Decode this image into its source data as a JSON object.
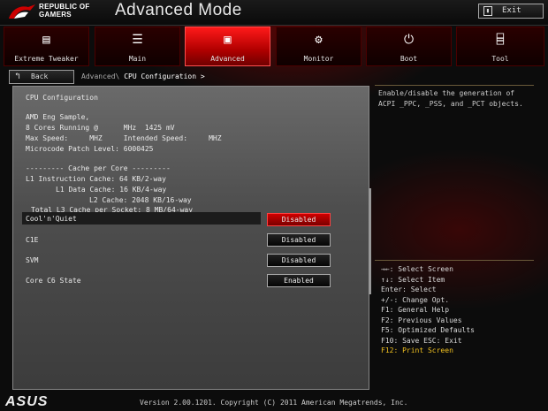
{
  "header": {
    "brand_line1": "REPUBLIC OF",
    "brand_line2": "GAMERS",
    "title": "Advanced Mode",
    "exit_label": "Exit"
  },
  "tabs": [
    {
      "label": "Extreme Tweaker",
      "icon": "tweaker-icon"
    },
    {
      "label": "Main",
      "icon": "list-icon"
    },
    {
      "label": "Advanced",
      "icon": "advanced-icon",
      "active": true
    },
    {
      "label": "Monitor",
      "icon": "monitor-icon"
    },
    {
      "label": "Boot",
      "icon": "power-icon"
    },
    {
      "label": "Tool",
      "icon": "tool-icon"
    }
  ],
  "nav": {
    "back_label": "Back",
    "breadcrumb_prefix": "Advanced\\",
    "breadcrumb_current": "CPU Configuration >"
  },
  "info": {
    "section_title": "CPU Configuration",
    "line1": "AMD Eng Sample,",
    "line2": "8 Cores Running @      MHz  1425 mV",
    "line3": "Max Speed:     MHZ     Intended Speed:     MHZ",
    "line4": "Microcode Patch Level: 6000425",
    "cache_header": "--------- Cache per Core ---------",
    "l1i": "L1 Instruction Cache: 64 KB/2-way",
    "l1d": "L1 Data Cache: 16 KB/4-way",
    "l2": "L2 Cache: 2048 KB/16-way",
    "l3": "Total L3 Cache per Socket: 8 MB/64-way"
  },
  "settings": [
    {
      "label": "Cool'n'Quiet",
      "value": "Disabled",
      "selected": true
    },
    {
      "label": "C1E",
      "value": "Disabled"
    },
    {
      "label": "SVM",
      "value": "Disabled"
    },
    {
      "label": "Core C6 State",
      "value": "Enabled"
    }
  ],
  "help": {
    "text_line1": "Enable/disable the generation of",
    "text_line2": "ACPI _PPC, _PSS, and _PCT objects."
  },
  "keys": [
    "→←: Select Screen",
    "↑↓: Select Item",
    "Enter: Select",
    "+/-: Change Opt.",
    "F1: General Help",
    "F2: Previous Values",
    "F5: Optimized Defaults",
    "F10: Save  ESC: Exit"
  ],
  "key_highlight": "F12: Print Screen",
  "footer": {
    "logo": "ASUS",
    "version": "Version 2.00.1201. Copyright (C) 2011 American Megatrends, Inc."
  },
  "colors": {
    "accent": "#d00000",
    "highlight_key": "#f0c020"
  }
}
